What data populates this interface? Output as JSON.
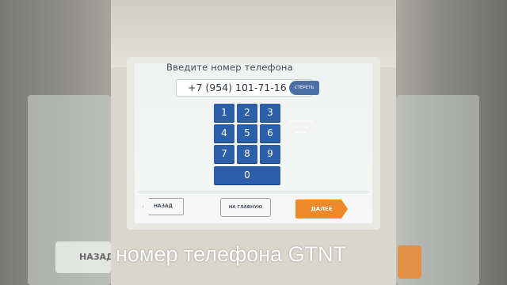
{
  "screen": {
    "title": "Введите номер телефона",
    "phone_value": "+7 (954) 101-71-16",
    "erase_label": "СТЕРЕТЬ",
    "keypad": [
      "1",
      "2",
      "3",
      "4",
      "5",
      "6",
      "7",
      "8",
      "9",
      "0"
    ],
    "back_label": "НАЗАД",
    "home_label": "НА ГЛАВНУЮ",
    "next_label": "ДАЛЕЕ"
  },
  "background_blur": {
    "back_label": "НАЗАД"
  },
  "caption": "номер телефона GTNT",
  "colors": {
    "key_blue": "#2d5ea8",
    "next_orange": "#ef8a2a",
    "screen_bg": "#f3f5f4"
  }
}
